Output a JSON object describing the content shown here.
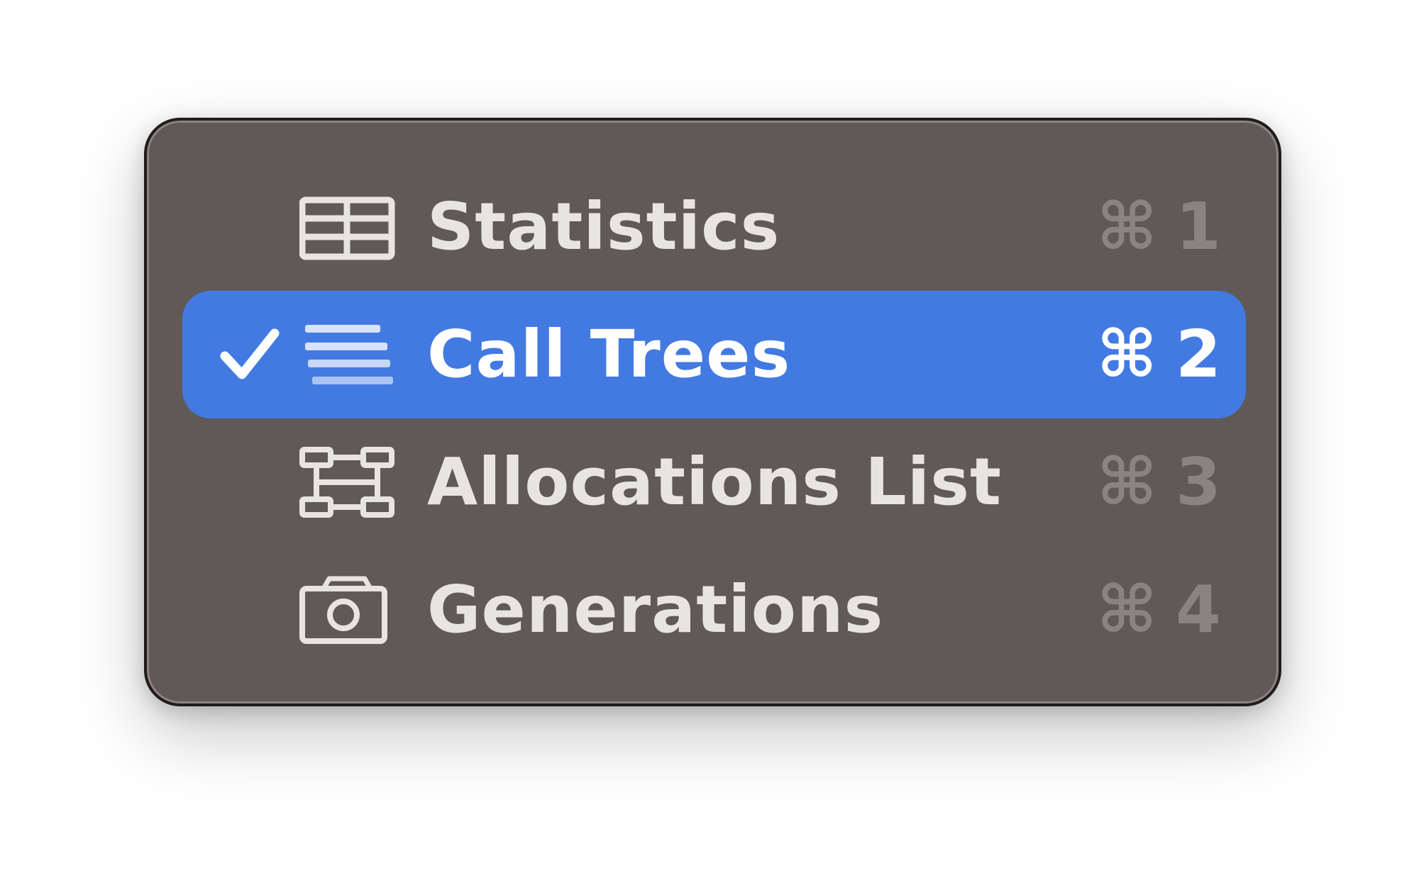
{
  "menu": {
    "items": [
      {
        "label": "Statistics",
        "icon": "table-icon",
        "shortcut_symbol": "⌘",
        "shortcut_key": "1",
        "selected": false
      },
      {
        "label": "Call Trees",
        "icon": "list-lines-icon",
        "shortcut_symbol": "⌘",
        "shortcut_key": "2",
        "selected": true
      },
      {
        "label": "Allocations List",
        "icon": "allocation-blocks-icon",
        "shortcut_symbol": "⌘",
        "shortcut_key": "3",
        "selected": false
      },
      {
        "label": "Generations",
        "icon": "camera-icon",
        "shortcut_symbol": "⌘",
        "shortcut_key": "4",
        "selected": false
      }
    ]
  },
  "colors": {
    "menu_background": "#615957",
    "selection": "#437ae2",
    "text": "#e8e4e2",
    "shortcut_dim": "#8a8381"
  }
}
